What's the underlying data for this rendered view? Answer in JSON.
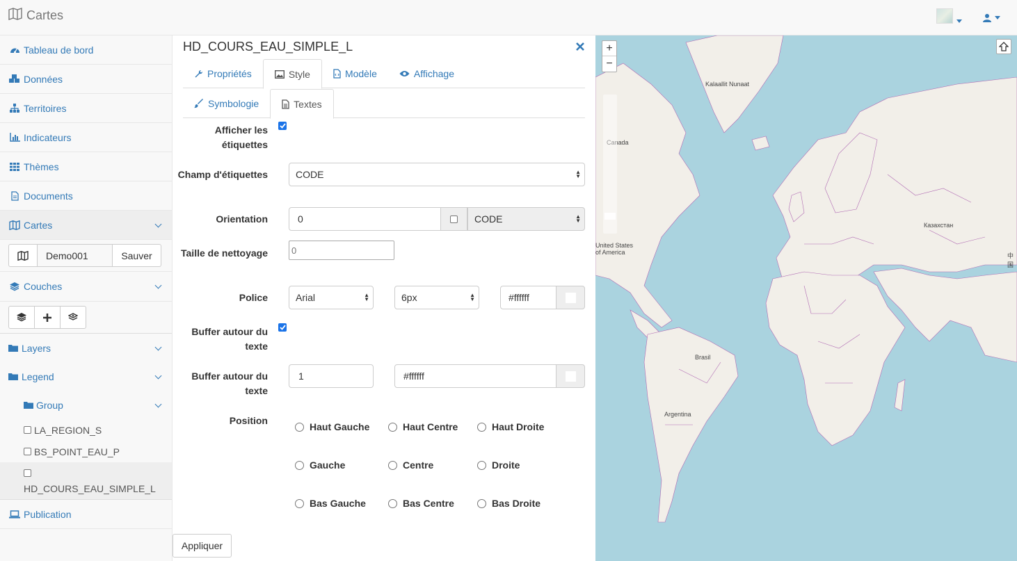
{
  "app": {
    "title": "Cartes"
  },
  "sidebar": {
    "items": [
      {
        "label": "Tableau de bord"
      },
      {
        "label": "Données"
      },
      {
        "label": "Territoires"
      },
      {
        "label": "Indicateurs"
      },
      {
        "label": "Thèmes"
      },
      {
        "label": "Documents"
      },
      {
        "label": "Cartes"
      }
    ],
    "map_name": "Demo001",
    "save_label": "Sauver",
    "couches_label": "Couches",
    "layers_label": "Layers",
    "legend_label": "Legend",
    "group_label": "Group",
    "legend_items": [
      "LA_REGION_S",
      "BS_POINT_EAU_P",
      "HD_COURS_EAU_SIMPLE_L"
    ],
    "publication_label": "Publication"
  },
  "panel": {
    "title": "HD_COURS_EAU_SIMPLE_L",
    "tabs": [
      "Propriétés",
      "Style",
      "Modèle",
      "Affichage"
    ],
    "subtabs": [
      "Symbologie",
      "Textes"
    ],
    "form": {
      "show_labels": "Afficher les étiquettes",
      "label_field": "Champ d'étiquettes",
      "label_field_value": "CODE",
      "orientation": "Orientation",
      "orientation_value": "0",
      "orientation_field": "CODE",
      "cleanup_size": "Taille de nettoyage",
      "cleanup_placeholder": "0",
      "font": "Police",
      "font_family": "Arial",
      "font_size": "6px",
      "font_color": "#ffffff",
      "buffer_toggle": "Buffer autour du texte",
      "buffer_size": "Buffer autour du texte",
      "buffer_size_value": "1",
      "buffer_color": "#ffffff",
      "position": "Position",
      "positions": [
        "Haut Gauche",
        "Haut Centre",
        "Haut Droite",
        "Gauche",
        "Centre",
        "Droite",
        "Bas Gauche",
        "Bas Centre",
        "Bas Droite"
      ]
    },
    "apply_label": "Appliquer"
  },
  "map": {
    "labels": [
      "Kalaallit Nunaat",
      "Canada",
      "United States of America",
      "Казахстан",
      "Brasil",
      "Argentina",
      "中国"
    ]
  },
  "colors": {
    "accent": "#337ab7",
    "ocean": "#aad3df",
    "land": "#f2efe9",
    "border": "#b06ab3"
  }
}
